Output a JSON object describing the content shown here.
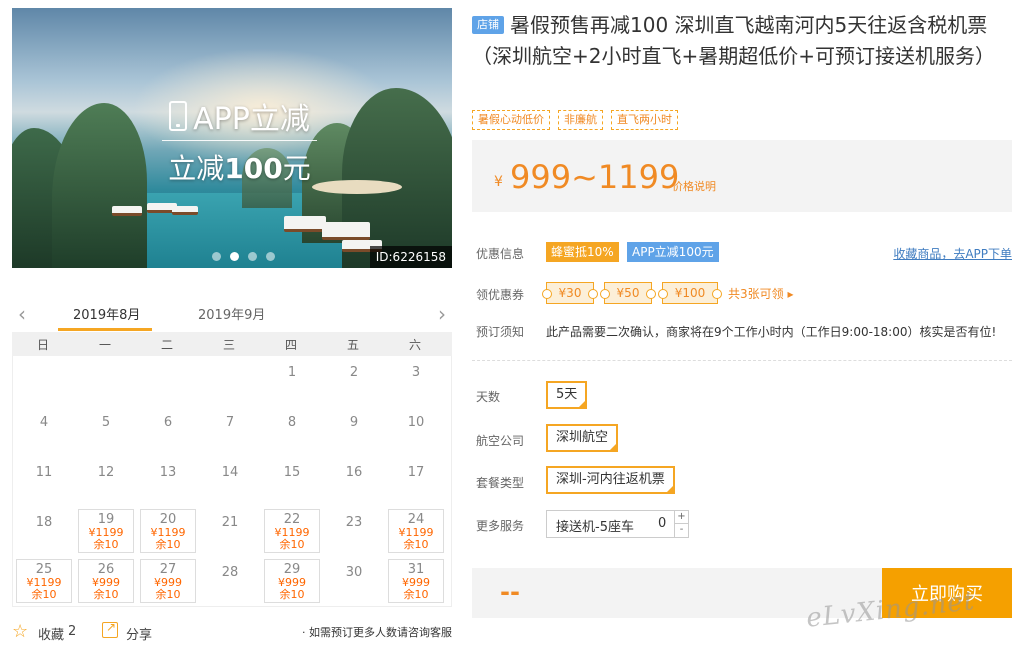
{
  "hero": {
    "promo_line1": "APP立减",
    "promo_line2_prefix": "立减",
    "promo_line2_amount": "100",
    "promo_line2_suffix": "元",
    "id_tag": "ID:6226158",
    "slides": 4,
    "active_slide": 1
  },
  "calendar": {
    "prev_icon": "chevron-left-icon",
    "next_icon": "chevron-right-icon",
    "months": [
      "2019年8月",
      "2019年9月"
    ],
    "weekdays": [
      "日",
      "一",
      "二",
      "三",
      "四",
      "五",
      "六"
    ],
    "days": [
      {
        "d": ""
      },
      {
        "d": ""
      },
      {
        "d": ""
      },
      {
        "d": ""
      },
      {
        "d": "1"
      },
      {
        "d": "2"
      },
      {
        "d": "3"
      },
      {
        "d": "4"
      },
      {
        "d": "5"
      },
      {
        "d": "6"
      },
      {
        "d": "7"
      },
      {
        "d": "8"
      },
      {
        "d": "9"
      },
      {
        "d": "10"
      },
      {
        "d": "11"
      },
      {
        "d": "12"
      },
      {
        "d": "13"
      },
      {
        "d": "14"
      },
      {
        "d": "15"
      },
      {
        "d": "16"
      },
      {
        "d": "17"
      },
      {
        "d": "18"
      },
      {
        "d": "19",
        "p": "¥1199",
        "s": "余10"
      },
      {
        "d": "20",
        "p": "¥1199",
        "s": "余10"
      },
      {
        "d": "21"
      },
      {
        "d": "22",
        "p": "¥1199",
        "s": "余10"
      },
      {
        "d": "23"
      },
      {
        "d": "24",
        "p": "¥1199",
        "s": "余10"
      },
      {
        "d": "25",
        "p": "¥1199",
        "s": "余10"
      },
      {
        "d": "26",
        "p": "¥999",
        "s": "余10"
      },
      {
        "d": "27",
        "p": "¥999",
        "s": "余10"
      },
      {
        "d": "28"
      },
      {
        "d": "29",
        "p": "¥999",
        "s": "余10"
      },
      {
        "d": "30"
      },
      {
        "d": "31",
        "p": "¥999",
        "s": "余10"
      }
    ]
  },
  "footer_left": {
    "fav_label": "收藏",
    "fav_count": "2",
    "share_label": "分享",
    "note": "· 如需预订更多人数请咨询客服"
  },
  "product": {
    "shop_badge": "店铺",
    "title": "暑假预售再减100 深圳直飞越南河内5天往返含税机票（深圳航空+2小时直飞+暑期超低价+可预订接送机服务）",
    "tags": [
      "暑假心动低价",
      "非廉航",
      "直飞两小时"
    ],
    "price_symbol": "¥",
    "price_range": "999~1199",
    "price_explain": "价格说明"
  },
  "offers": {
    "label_discount": "优惠信息",
    "bee": "蜂蜜抵10%",
    "app_cut": "APP立减100元",
    "fav_link": "收藏商品，去APP下单",
    "label_coupon": "领优惠券",
    "coupons": [
      "¥30",
      "¥50",
      "¥100"
    ],
    "coupon_more": "共3张可领 ▸",
    "label_notice": "预订须知",
    "notice": "此产品需要二次确认，商家将在9个工作小时内（工作日9:00-18:00）核实是否有位!"
  },
  "options": {
    "days_label": "天数",
    "days_value": "5天",
    "airline_label": "航空公司",
    "airline_value": "深圳航空",
    "package_label": "套餐类型",
    "package_value": "深圳-河内往返机票",
    "service_label": "更多服务",
    "service_name": "接送机-5座车",
    "service_qty": "0",
    "plus": "+",
    "minus": "-"
  },
  "buy": {
    "total": "--",
    "button": "立即购买"
  },
  "watermark": "eLvXing.net",
  "colors": {
    "accent": "#f5a623",
    "price": "#f08a24",
    "blue": "#5fa3e8",
    "buy_button": "#f5a000"
  }
}
